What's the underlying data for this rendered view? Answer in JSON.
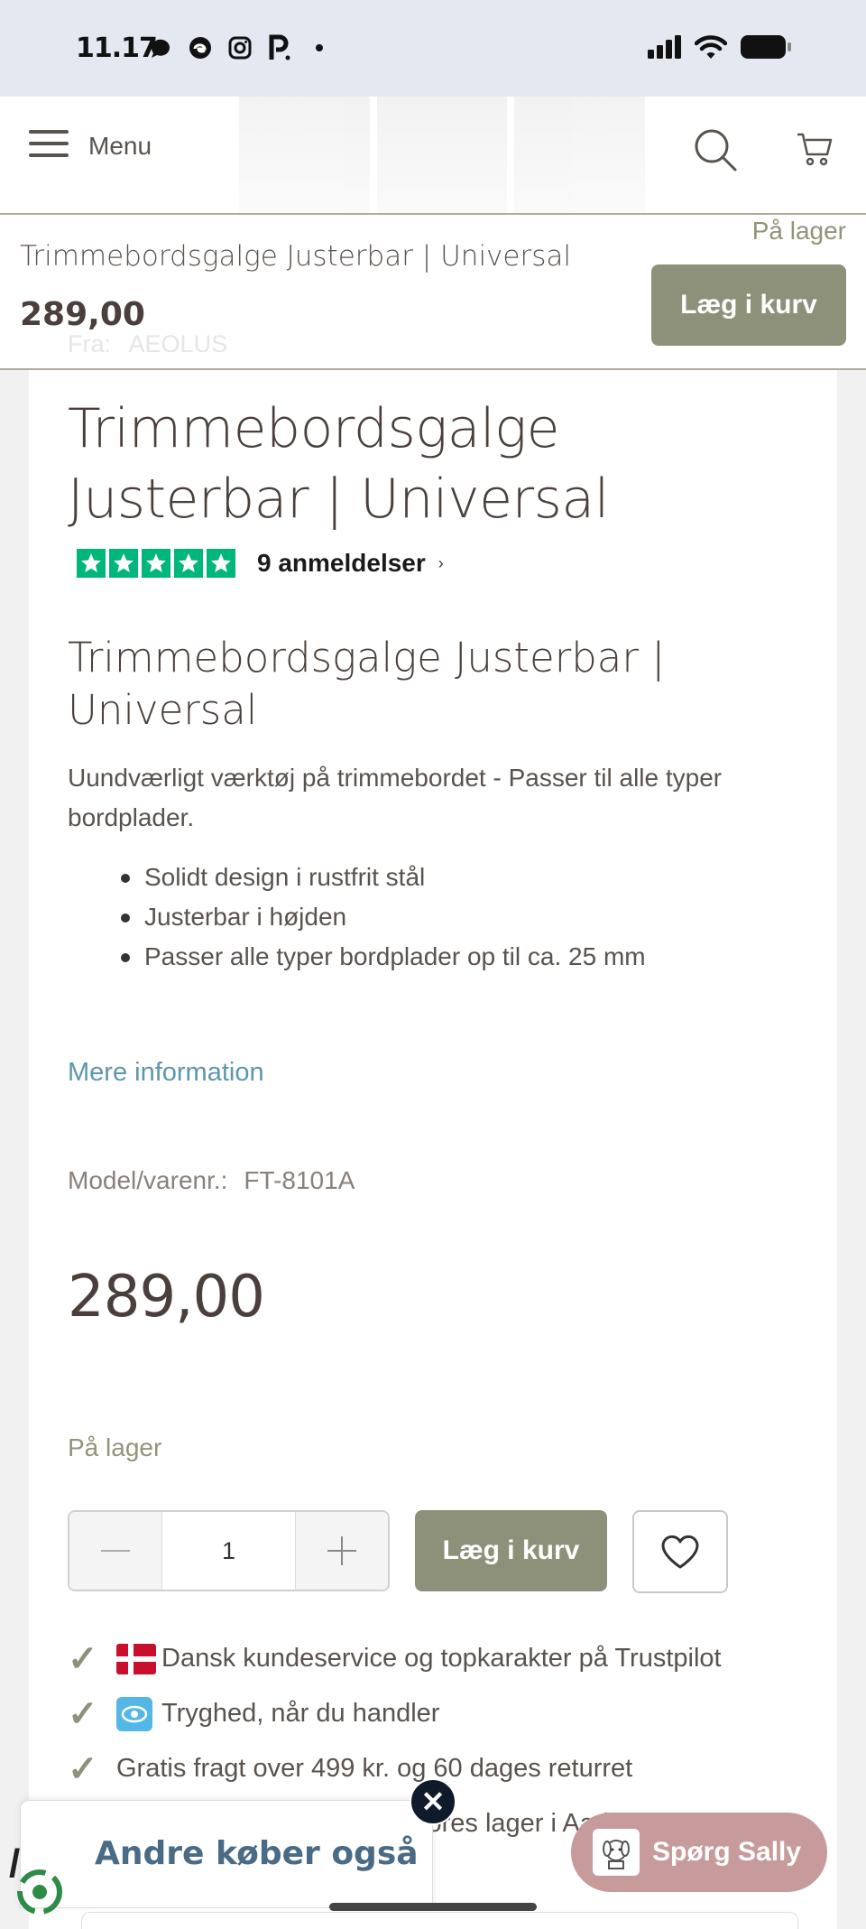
{
  "status_bar": {
    "time": "11.17",
    "left_icons": [
      "threads-icon",
      "edge-icon",
      "instagram-icon",
      "p-icon",
      "dot-icon"
    ],
    "right_icons": [
      "signal-icon",
      "wifi-icon",
      "battery-icon"
    ]
  },
  "header": {
    "menu_label": "Menu",
    "icons": [
      "hamburger-icon",
      "search-icon",
      "cart-icon"
    ]
  },
  "sticky": {
    "title": "Trimmebordsgalge Justerbar | Universal",
    "price": "289,00",
    "from_label": "Fra:",
    "brand": "AEOLUS",
    "stock": "På lager",
    "add_to_cart": "Læg i kurv"
  },
  "product": {
    "title": "Trimmebordsgalge Justerbar | Universal",
    "rating": {
      "stars": 5,
      "reviews_label": "9 anmeldelser",
      "color": "#00b67a"
    },
    "subtitle": "Trimmebordsgalge Justerbar | Universal",
    "description": "Uundværligt værktøj på trimmebordet - Passer til alle typer bordplader.",
    "features": [
      "Solidt design i rustfrit stål",
      "Justerbar i højden",
      "Passer alle typer bordplader op til ca. 25 mm"
    ],
    "more_info": "Mere information",
    "model_label": "Model/varenr.:",
    "model_value": "FT-8101A",
    "price": "289,00",
    "stock": "På lager",
    "quantity": "1",
    "add_to_cart": "Læg i kurv"
  },
  "usps": [
    "Dansk kundeservice og topkarakter på Trustpilot",
    "Tryghed, når du handler",
    "Gratis fragt over 499 kr. og 60 dages returret",
    "vores lager i Aarhus"
  ],
  "overlays": {
    "also_bought": "Andre køber også",
    "ask_sally": "Spørg Sally",
    "close": "✕"
  },
  "colors": {
    "accent_button": "#8e917a",
    "link": "#5c97ad",
    "stock": "#929378",
    "sally": "#c79a9c",
    "trustpilot": "#00b67a"
  }
}
